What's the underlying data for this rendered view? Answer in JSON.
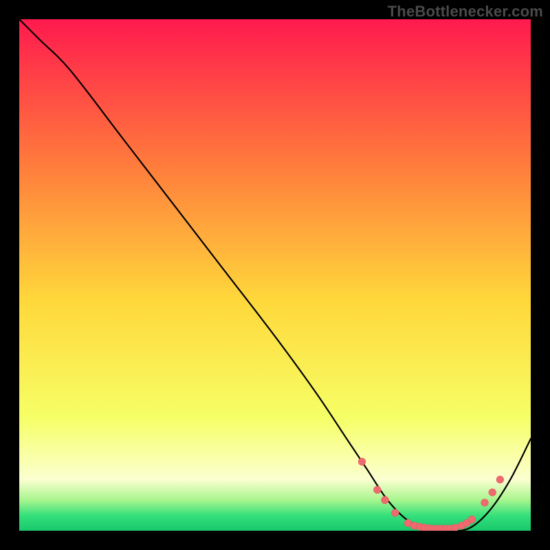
{
  "watermark": "TheBottlenecker.com",
  "colors": {
    "bg_black": "#000000",
    "curve": "#000000",
    "marker_fill": "#ef6a6f",
    "marker_stroke": "#e25a60",
    "grad_top": "#ff1a4e",
    "grad_upper": "#ff7a3c",
    "grad_mid": "#ffd83b",
    "grad_lower": "#f6ff66",
    "grad_pale": "#fbffd0",
    "grad_green1": "#a8f58e",
    "grad_green2": "#35e07b",
    "grad_green3": "#18c86c"
  },
  "chart_data": {
    "type": "line",
    "title": "",
    "xlabel": "",
    "ylabel": "",
    "xlim": [
      0,
      100
    ],
    "ylim": [
      0,
      100
    ],
    "series": [
      {
        "name": "bottleneck-curve",
        "x": [
          0,
          4,
          10,
          20,
          30,
          40,
          50,
          58,
          64,
          68,
          72,
          76,
          80,
          84,
          88,
          92,
          96,
          100
        ],
        "y": [
          100,
          96,
          90,
          77,
          64,
          51,
          38,
          27,
          18,
          12,
          6,
          2,
          0.5,
          0,
          0.5,
          4,
          10,
          18
        ]
      }
    ],
    "markers": {
      "name": "highlight-dots",
      "x": [
        67,
        70,
        71.5,
        73.5,
        76,
        77.2,
        78.3,
        79.2,
        80,
        80.8,
        81.6,
        82.4,
        83.3,
        84.2,
        85.2,
        86.5,
        87.5,
        88.5,
        91,
        92.5,
        94
      ],
      "y": [
        13.5,
        8,
        6,
        3.5,
        1.5,
        1.0,
        0.8,
        0.6,
        0.5,
        0.4,
        0.4,
        0.4,
        0.4,
        0.4,
        0.6,
        1.0,
        1.5,
        2.2,
        5.5,
        7.5,
        10
      ]
    }
  }
}
